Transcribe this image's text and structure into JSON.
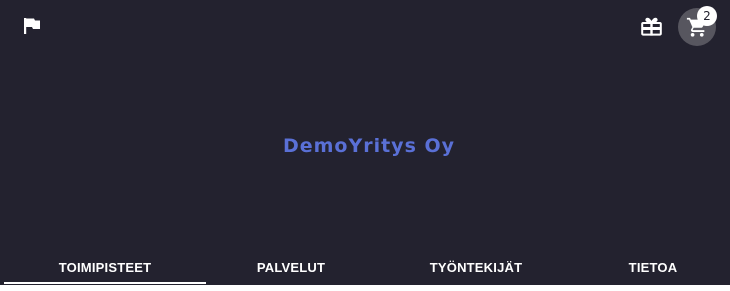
{
  "header": {
    "language_icon": "flag-icon",
    "gift_icon": "gift-card-icon",
    "cart_icon": "shopping-cart-icon",
    "cart_count": "2"
  },
  "brand": {
    "name": "DemoYritys Oy",
    "color": "#5a70d6"
  },
  "tabs": [
    {
      "label": "TOIMIPISTEET",
      "active": true
    },
    {
      "label": "PALVELUT",
      "active": false
    },
    {
      "label": "TYÖNTEKIJÄT",
      "active": false
    },
    {
      "label": "TIETOA",
      "active": false
    }
  ],
  "colors": {
    "background": "#23222f",
    "cart_button": "#57565f",
    "text": "#ffffff"
  }
}
